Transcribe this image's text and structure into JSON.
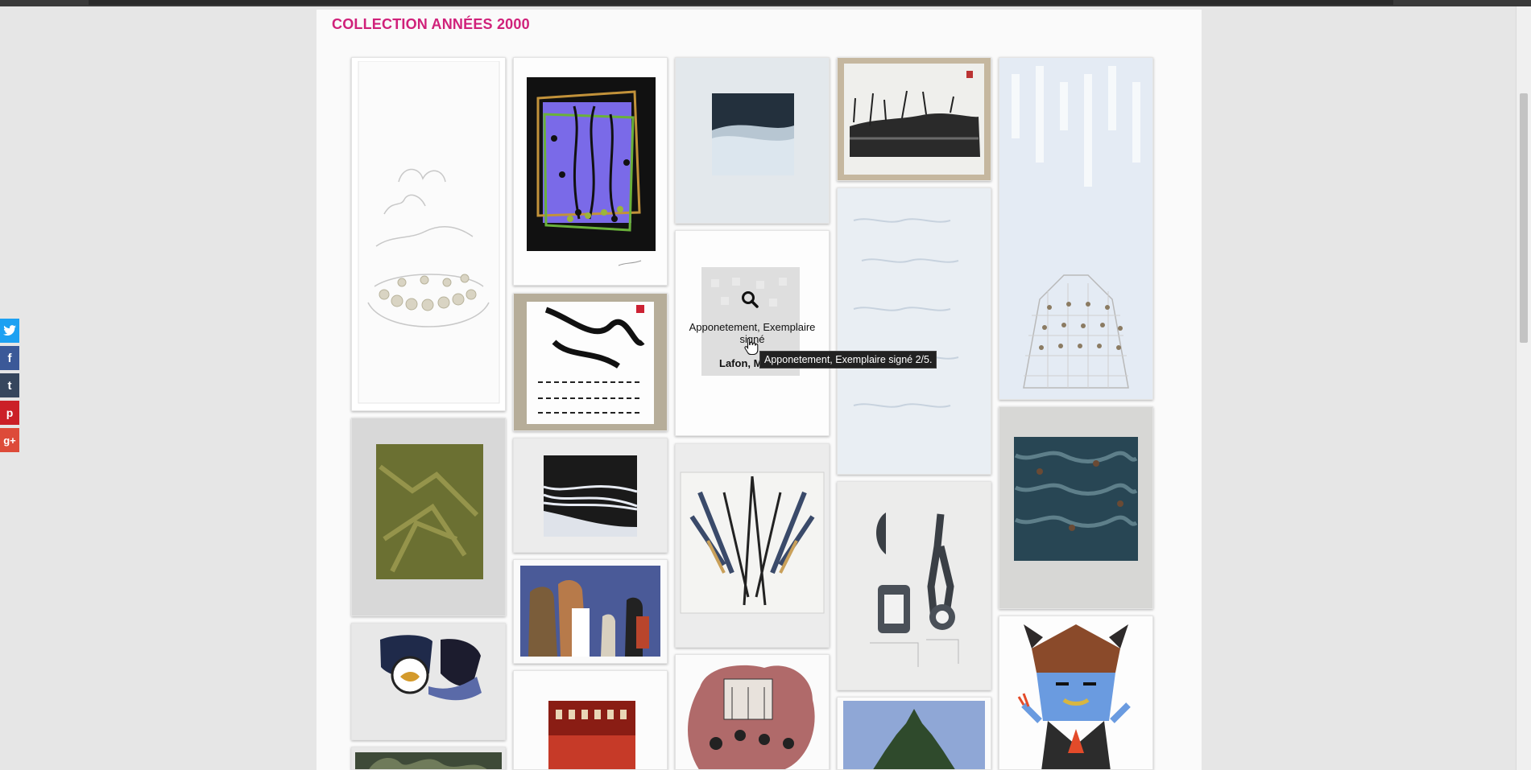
{
  "page": {
    "title": "COLLECTION ANNÉES 2000"
  },
  "social": [
    {
      "name": "twitter-share",
      "glyph": "t",
      "color": "#1da1f2"
    },
    {
      "name": "facebook-share",
      "glyph": "f",
      "color": "#3b5998"
    },
    {
      "name": "tumblr-share",
      "glyph": "t",
      "color": "#36465d"
    },
    {
      "name": "pinterest-share",
      "glyph": "p",
      "color": "#cb2027"
    },
    {
      "name": "googleplus-share",
      "glyph": "g+",
      "color": "#dd4b39"
    }
  ],
  "hovered_card": {
    "caption": "Apponetement, Exemplaire signé",
    "artist": "Lafon, M",
    "tooltip": "Apponetement, Exemplaire signé 2/5."
  }
}
